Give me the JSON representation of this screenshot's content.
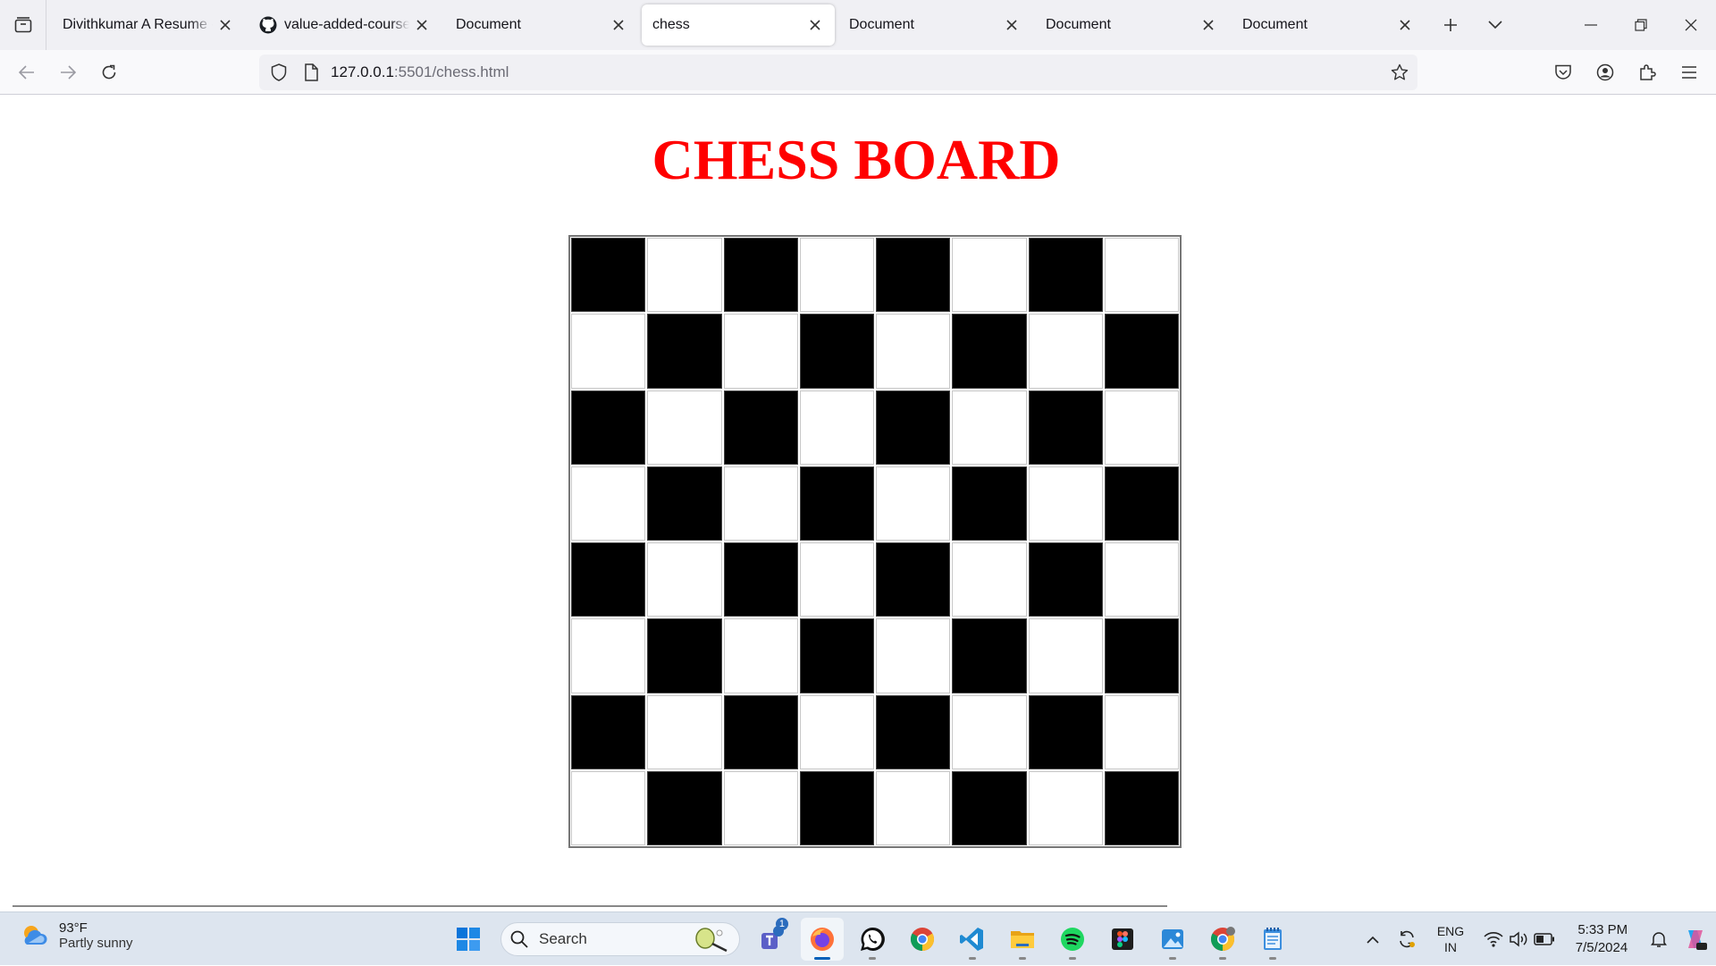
{
  "browser": {
    "tabs": [
      {
        "title": "Divithkumar A Resume - Divithkumar",
        "active": false,
        "favicon": "none"
      },
      {
        "title": "value-added-course/index",
        "active": false,
        "favicon": "github-icon"
      },
      {
        "title": "Document",
        "active": false,
        "favicon": "none"
      },
      {
        "title": "chess",
        "active": true,
        "favicon": "none"
      },
      {
        "title": "Document",
        "active": false,
        "favicon": "none"
      },
      {
        "title": "Document",
        "active": false,
        "favicon": "none"
      },
      {
        "title": "Document",
        "active": false,
        "favicon": "none"
      }
    ],
    "url": {
      "host": "127.0.0.1",
      "rest": ":5501/chess.html"
    }
  },
  "page": {
    "heading": "CHESS BOARD",
    "heading_color": "#ff0000",
    "board": {
      "rows": 8,
      "cols": 8,
      "top_left": "black",
      "colors": {
        "dark": "#000000",
        "light": "#ffffff"
      }
    }
  },
  "taskbar": {
    "weather": {
      "temp": "93°F",
      "desc": "Partly sunny"
    },
    "search_placeholder": "Search",
    "teams_badge": "1",
    "lang": {
      "line1": "ENG",
      "line2": "IN"
    },
    "clock": {
      "time": "5:33 PM",
      "date": "7/5/2024"
    },
    "pinned": [
      "windows-start-icon",
      "teams-icon",
      "firefox-icon",
      "whatsapp-icon",
      "chrome-icon",
      "vscode-icon",
      "file-explorer-icon",
      "spotify-icon",
      "figma-icon",
      "photos-icon",
      "chrome-profile-icon",
      "notepad-icon"
    ]
  }
}
